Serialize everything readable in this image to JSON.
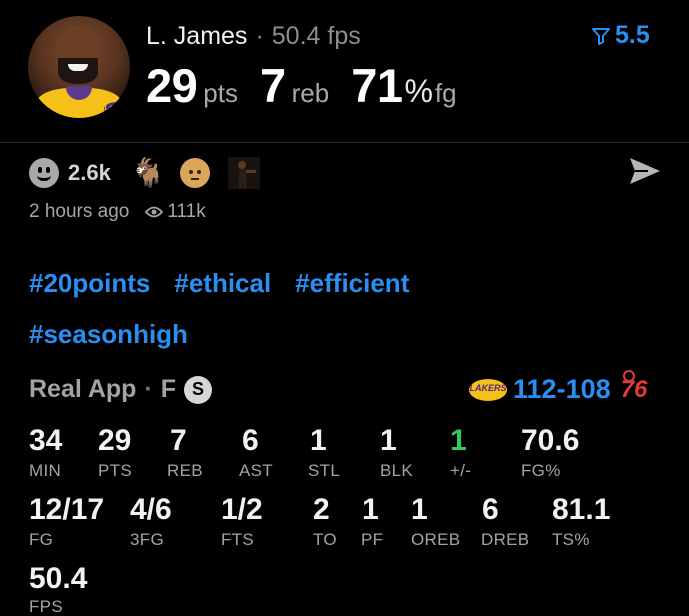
{
  "player": {
    "name": "L. James",
    "fps_text": "50.4 fps",
    "pts": "29",
    "pts_unit": "pts",
    "reb": "7",
    "reb_unit": "reb",
    "fg_pct": "71",
    "pct_sign": "%",
    "fg_unit": "fg"
  },
  "filter": {
    "value": "5.5",
    "icon": "funnel-icon"
  },
  "reactions": {
    "count": "2.6k",
    "icons": [
      "smiley-icon",
      "goat-emoji",
      "face-emoji",
      "dancer-gif"
    ],
    "goat": "🐐"
  },
  "post": {
    "time": "2 hours ago",
    "views": "111k"
  },
  "hashtags": [
    "#20points",
    "#ethical",
    "#efficient",
    "#seasonhigh"
  ],
  "box": {
    "source": "Real App",
    "position": "F",
    "badge": "S",
    "home_logo_text": "LAKERS",
    "home_score": "112",
    "dash": "-",
    "away_score": "108",
    "away_logo_text": "76",
    "accent": "#2a8ff0",
    "positive": "#34c759"
  },
  "stats_row1": [
    {
      "value": "34",
      "label": "MIN"
    },
    {
      "value": "29",
      "label": "PTS"
    },
    {
      "value": "7",
      "label": "REB"
    },
    {
      "value": "6",
      "label": "AST"
    },
    {
      "value": "1",
      "label": "STL"
    },
    {
      "value": "1",
      "label": "BLK"
    },
    {
      "value": "1",
      "label": "+/-"
    },
    {
      "value": "70.6",
      "label": "FG%"
    }
  ],
  "stats_row2": [
    {
      "value": "12/17",
      "label": "FG"
    },
    {
      "value": "4/6",
      "label": "3FG"
    },
    {
      "value": "1/2",
      "label": "FTS"
    },
    {
      "value": "2",
      "label": "TO"
    },
    {
      "value": "1",
      "label": "PF"
    },
    {
      "value": "1",
      "label": "OREB"
    },
    {
      "value": "6",
      "label": "DREB"
    },
    {
      "value": "81.1",
      "label": "TS%"
    }
  ],
  "stats_row3": [
    {
      "value": "50.4",
      "label": "FPS"
    }
  ]
}
